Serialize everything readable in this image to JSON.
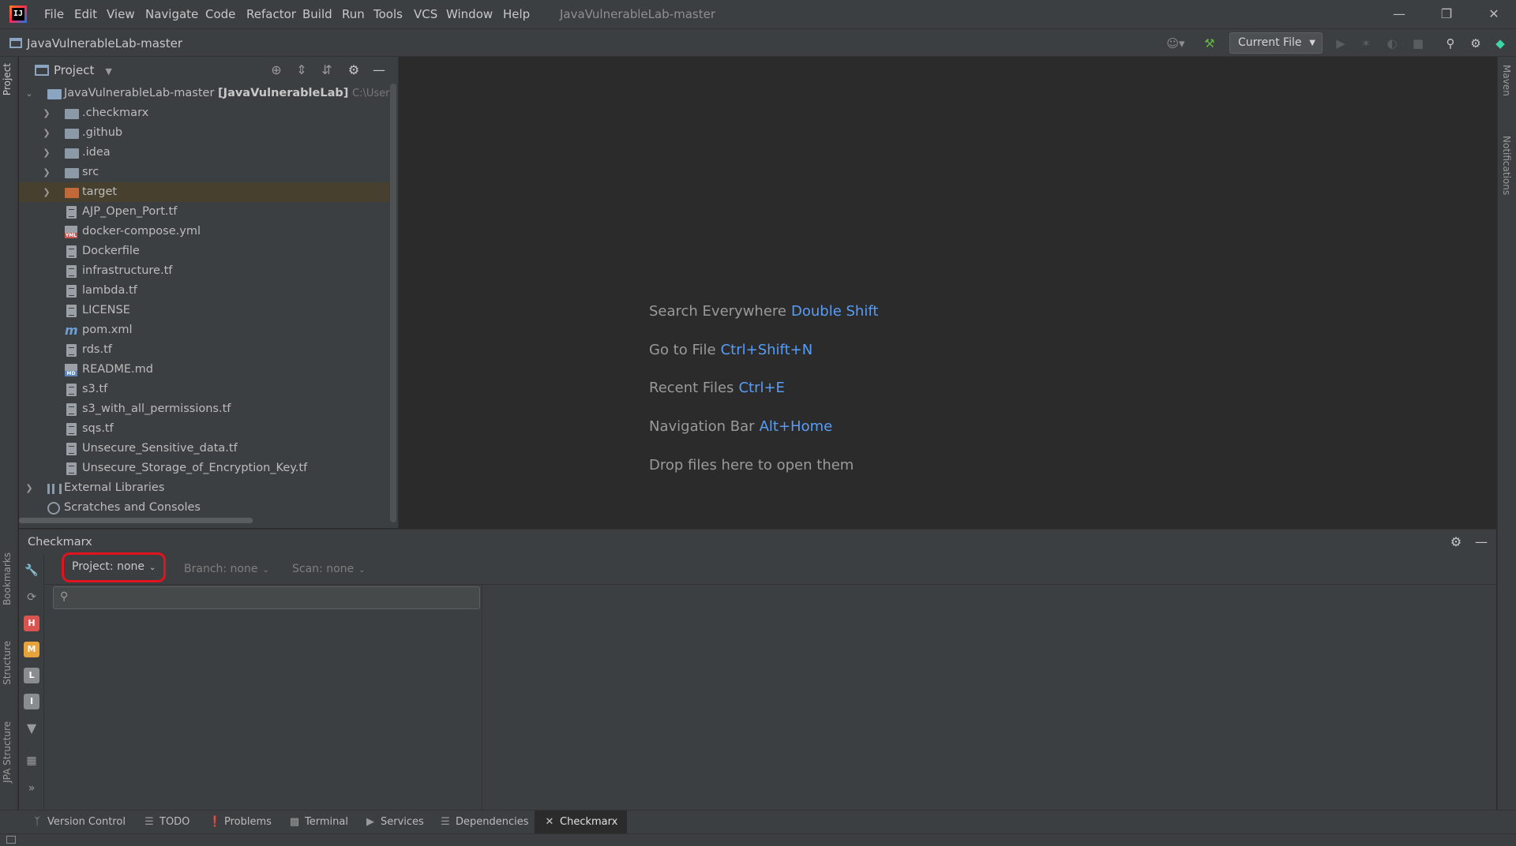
{
  "title_bar": {
    "menu": [
      "File",
      "Edit",
      "View",
      "Navigate",
      "Code",
      "Refactor",
      "Build",
      "Run",
      "Tools",
      "VCS",
      "Window",
      "Help"
    ],
    "window_title": "JavaVulnerableLab-master",
    "logo_text": "IJ"
  },
  "nav_bar": {
    "project_name": "JavaVulnerableLab-master",
    "run_config": "Current File"
  },
  "left_stripe": {
    "top_tab": "Project",
    "bottom_tabs": [
      "Bookmarks",
      "Structure",
      "JPA Structure"
    ]
  },
  "right_stripe": {
    "tabs": [
      "Maven",
      "Notifications"
    ]
  },
  "project_panel": {
    "header": "Project",
    "root": {
      "name": "JavaVulnerableLab-master",
      "module": "[JavaVulnerableLab]",
      "path": "C:\\Users\\avir\\"
    },
    "folders": [
      ".checkmarx",
      ".github",
      ".idea",
      "src",
      "target"
    ],
    "files": [
      "AJP_Open_Port.tf",
      "docker-compose.yml",
      "Dockerfile",
      "infrastructure.tf",
      "lambda.tf",
      "LICENSE",
      "pom.xml",
      "rds.tf",
      "README.md",
      "s3.tf",
      "s3_with_all_permissions.tf",
      "sqs.tf",
      "Unsecure_Sensitive_data.tf",
      "Unsecure_Storage_of_Encryption_Key.tf"
    ],
    "external_libraries": "External Libraries",
    "scratches": "Scratches and Consoles"
  },
  "editor_hints": [
    {
      "label": "Search Everywhere",
      "key": "Double Shift"
    },
    {
      "label": "Go to File",
      "key": "Ctrl+Shift+N"
    },
    {
      "label": "Recent Files",
      "key": "Ctrl+E"
    },
    {
      "label": "Navigation Bar",
      "key": "Alt+Home"
    },
    {
      "label": "Drop files here to open them",
      "key": ""
    }
  ],
  "checkmarx": {
    "title": "Checkmarx",
    "project_combo": "Project: none",
    "branch_combo": "Branch: none",
    "scan_combo": "Scan: none",
    "search_placeholder": "",
    "severity_badges": [
      "H",
      "M",
      "L",
      "I"
    ],
    "highlight_color": "#e0141e"
  },
  "bottom_tabs": [
    "Version Control",
    "TODO",
    "Problems",
    "Terminal",
    "Services",
    "Dependencies",
    "Checkmarx"
  ],
  "colors": {
    "accent_link": "#589df6",
    "selected_row": "#47402e",
    "target_folder": "#c2693a"
  }
}
